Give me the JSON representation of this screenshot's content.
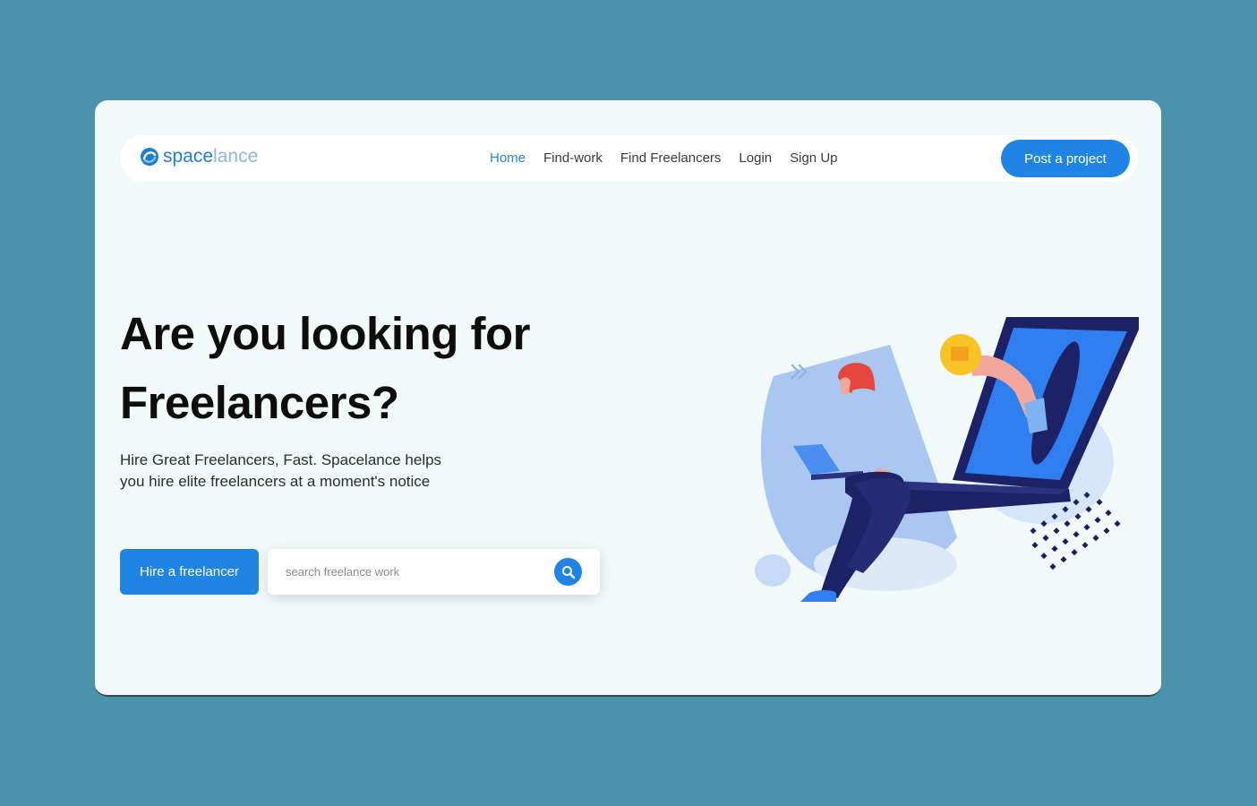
{
  "brand": {
    "name_primary": "space",
    "name_secondary": "lance",
    "icon": "logo-swirl-icon"
  },
  "nav": {
    "links": [
      {
        "label": "Home",
        "active": true
      },
      {
        "label": "Find-work",
        "active": false
      },
      {
        "label": "Find Freelancers",
        "active": false
      },
      {
        "label": "Login",
        "active": false
      },
      {
        "label": "Sign Up",
        "active": false
      }
    ],
    "cta_label": "Post a project"
  },
  "hero": {
    "headline_line1": "Are you looking for",
    "headline_line2": "Freelancers?",
    "subtext_line1": "Hire Great Freelancers, Fast. Spacelance helps",
    "subtext_line2": "you hire elite freelancers at a moment's notice",
    "hire_button_label": "Hire a freelancer",
    "search_placeholder": "search freelance work",
    "search_icon": "search-icon"
  },
  "colors": {
    "page_background": "#4a93ad",
    "card_background": "#f2f9f9",
    "accent": "#1f84e3",
    "nav_active": "#2a85da"
  }
}
